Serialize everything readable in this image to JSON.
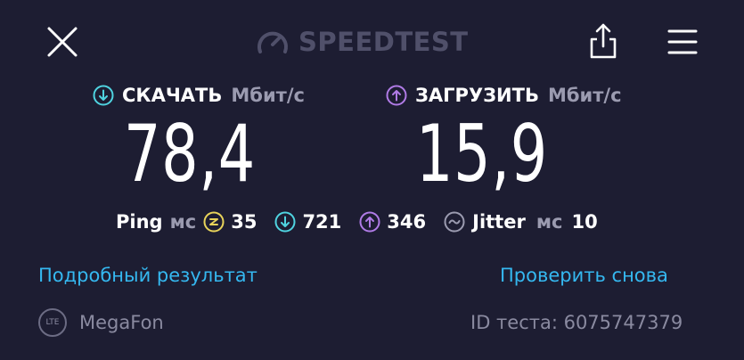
{
  "header": {
    "brand": "SPEEDTEST",
    "close_icon": "close-icon",
    "share_icon": "share-icon",
    "menu_icon": "hamburger-menu-icon"
  },
  "download": {
    "label": "СКАЧАТЬ",
    "unit": "Мбит/с",
    "value": "78,4",
    "icon": "arrow-down-circle-icon",
    "color": "#4fd3e0"
  },
  "upload": {
    "label": "ЗАГРУЗИТЬ",
    "unit": "Мбит/с",
    "value": "15,9",
    "icon": "arrow-up-circle-icon",
    "color": "#b07be6"
  },
  "stats": {
    "ping_label": "Ping",
    "ping_unit": "мс",
    "ping_idle": "35",
    "ping_download": "721",
    "ping_upload": "346",
    "jitter_label": "Jitter",
    "jitter_unit": "мс",
    "jitter_value": "10",
    "idle_color": "#e8d35a"
  },
  "links": {
    "details": "Подробный результат",
    "retest": "Проверить снова"
  },
  "footer": {
    "network_badge": "LTE",
    "provider": "MegaFon",
    "test_id": "ID теста: 6075747379"
  }
}
